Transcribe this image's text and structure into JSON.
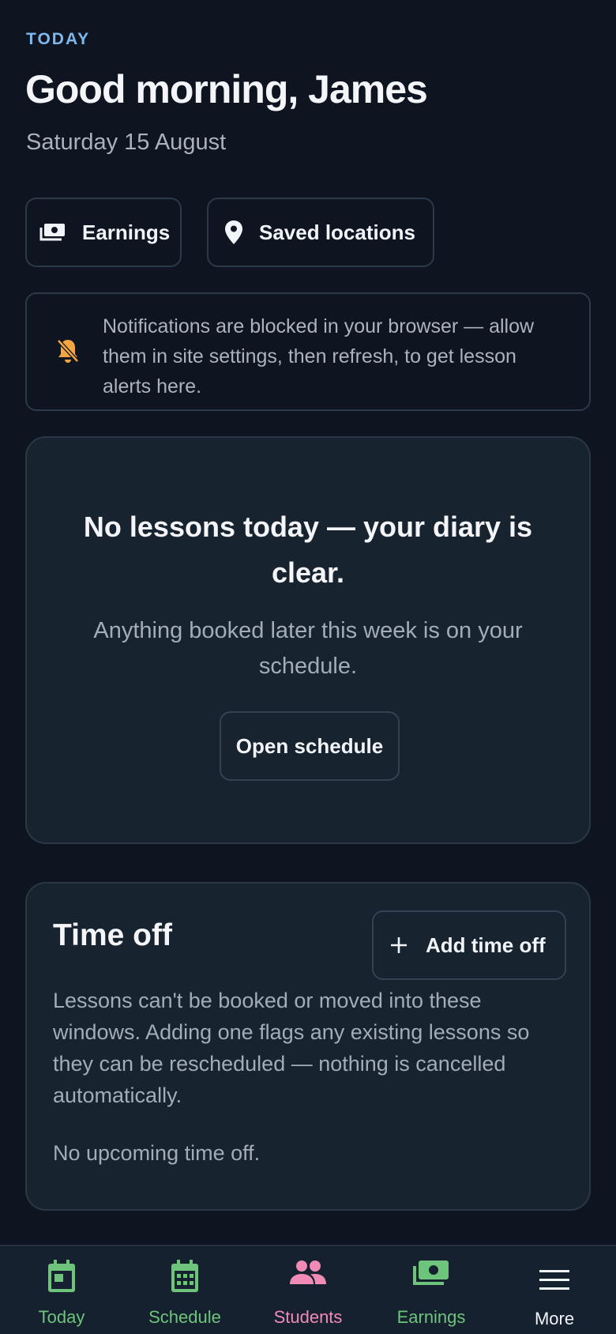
{
  "header": {
    "eyebrow": "TODAY",
    "greeting": "Good morning, James",
    "date": "Saturday 15 August"
  },
  "quick_links": {
    "earnings": {
      "label": "Earnings",
      "icon": "cash-icon"
    },
    "saved_locations": {
      "label": "Saved locations",
      "icon": "map-pin-icon"
    }
  },
  "notice": {
    "icon": "bell-off-icon",
    "text": "Notifications are blocked in your browser — allow them in site settings, then refresh, to get lesson alerts here."
  },
  "empty_state": {
    "title": "No lessons today — your diary is clear.",
    "subtitle": "Anything booked later this week is on your schedule.",
    "button_label": "Open schedule"
  },
  "time_off": {
    "title": "Time off",
    "add_button_label": "Add time off",
    "description": "Lessons can't be booked or moved into these windows. Adding one flags any existing lessons so they can be rescheduled — nothing is cancelled automatically.",
    "empty_text": "No upcoming time off."
  },
  "tabbar": {
    "items": [
      {
        "label": "Today",
        "icon": "calendar-today-icon",
        "color": "#6dc47a"
      },
      {
        "label": "Schedule",
        "icon": "calendar-grid-icon",
        "color": "#6dc47a"
      },
      {
        "label": "Students",
        "icon": "people-icon",
        "color": "#f08bb6"
      },
      {
        "label": "Earnings",
        "icon": "cash-icon",
        "color": "#6dc47a"
      },
      {
        "label": "More",
        "icon": "menu-icon",
        "color": "#f1f4f8"
      }
    ]
  },
  "colors": {
    "background": "#0e1520",
    "card": "#182330",
    "accent_blue": "#7fb8ec",
    "warning_amber": "#f2a541",
    "tab_green": "#6dc47a",
    "tab_pink": "#f08bb6"
  }
}
